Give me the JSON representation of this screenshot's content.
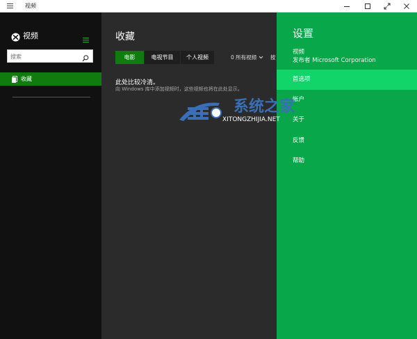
{
  "window": {
    "title": "视频",
    "hamburger_icon": "hamburger-icon",
    "controls": [
      "minimize-icon",
      "maximize-icon",
      "fullscreen-icon",
      "close-icon"
    ]
  },
  "sidebar": {
    "app_name": "视频",
    "logo_icon": "xbox-logo-icon",
    "menu_icon": "menu-icon",
    "search": {
      "placeholder": "搜索",
      "icon": "search-icon"
    },
    "items": [
      {
        "label": "收藏",
        "icon": "collection-icon",
        "active": true
      }
    ]
  },
  "main": {
    "title": "收藏",
    "tabs": [
      {
        "label": "电影",
        "active": true
      },
      {
        "label": "电视节目",
        "active": false
      },
      {
        "label": "个人视频",
        "active": false
      }
    ],
    "filter_label": "0 所有视频",
    "filter_label2": "按",
    "empty_title": "此处比较冷清。",
    "empty_subtitle": "向 Windows 库中添加视频时，这些视频也将在此处显示。"
  },
  "settings": {
    "title": "设置",
    "app_name": "视频",
    "publisher": "发布者 Microsoft Corporation",
    "items": [
      {
        "label": "首选项",
        "active": true
      },
      {
        "label": "帐户",
        "active": false
      },
      {
        "label": "关于",
        "active": false
      },
      {
        "label": "反馈",
        "active": false
      },
      {
        "label": "帮助",
        "active": false
      }
    ]
  },
  "watermark": {
    "text": "系统之家",
    "subtext": "XITONGZHIJIA.NET"
  },
  "colors": {
    "accent_green": "#107c10",
    "settings_green": "#07a74a",
    "settings_active": "#12d56a",
    "sidebar_bg": "#111111",
    "main_bg": "#2b2b2b"
  }
}
